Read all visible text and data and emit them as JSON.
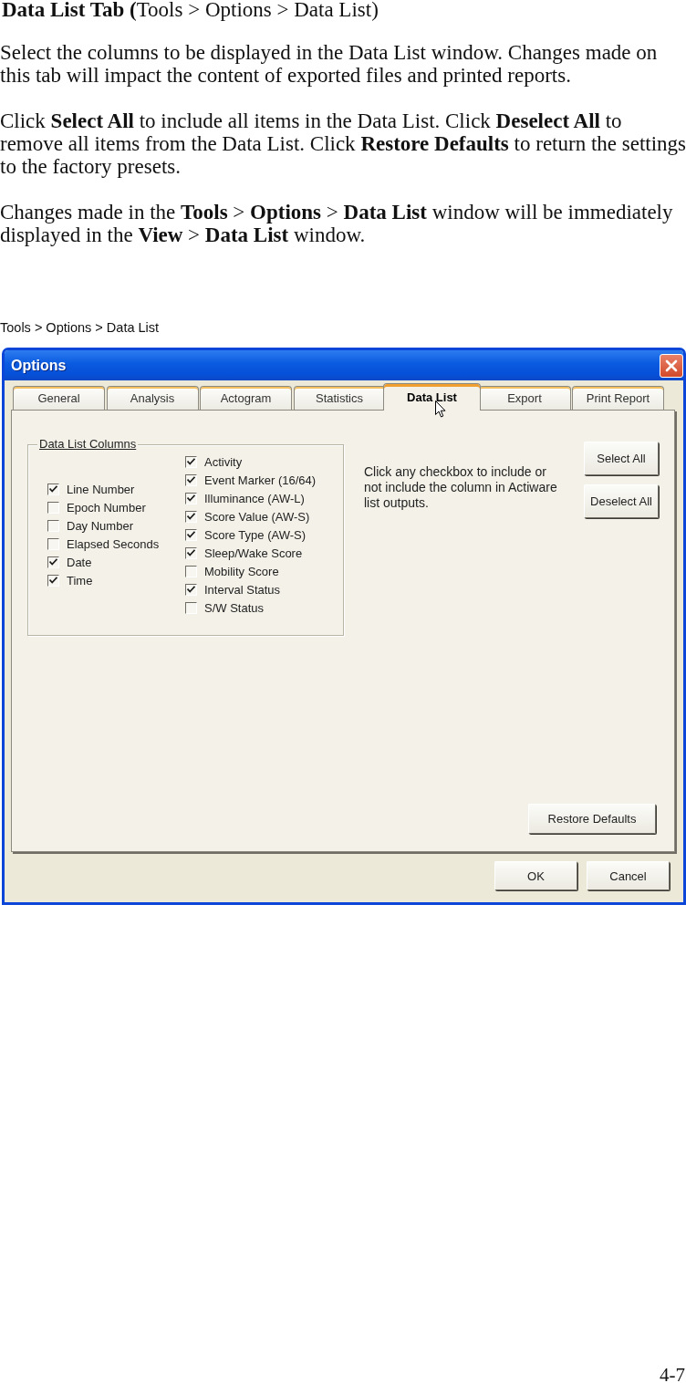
{
  "heading": "**Data List Tab (**Tools > Options > Data List)",
  "paragraphs": [
    "Select the columns to be displayed in the Data List window. Changes made on this tab will impact the content of exported files and printed reports.",
    "Click **Select All** to include all items in the Data List. Click **Deselect All** to remove all items from the Data List. Click **Restore Defaults** to return the settings to the factory presets.",
    "Changes made in the **Tools** > **Options** > **Data List** window will be immediately displayed in the **View** > **Data List** window."
  ],
  "caption": "Tools > Options > Data List",
  "dialog": {
    "title": "Options",
    "tabs": [
      {
        "label": "General",
        "selected": false
      },
      {
        "label": "Analysis",
        "selected": false
      },
      {
        "label": "Actogram",
        "selected": false
      },
      {
        "label": "Statistics",
        "selected": false
      },
      {
        "label": "Data List",
        "selected": true
      },
      {
        "label": "Export",
        "selected": false
      },
      {
        "label": "Print Report",
        "selected": false
      }
    ],
    "group_title": "Data List Columns",
    "checkbox_columns": [
      {
        "items": [
          {
            "label": "Line Number",
            "checked": true
          },
          {
            "label": "Epoch Number",
            "checked": false
          },
          {
            "label": "Day Number",
            "checked": false
          },
          {
            "label": "Elapsed Seconds",
            "checked": false
          },
          {
            "label": "Date",
            "checked": true
          },
          {
            "label": "Time",
            "checked": true
          }
        ]
      },
      {
        "items": [
          {
            "label": "Activity",
            "checked": true
          },
          {
            "label": "Event Marker (16/64)",
            "checked": true
          },
          {
            "label": "Illuminance (AW-L)",
            "checked": true
          },
          {
            "label": "Score Value (AW-S)",
            "checked": true
          },
          {
            "label": "Score Type (AW-S)",
            "checked": true
          },
          {
            "label": "Sleep/Wake Score",
            "checked": true
          },
          {
            "label": "Mobility Score",
            "checked": false
          },
          {
            "label": "Interval Status",
            "checked": true
          },
          {
            "label": "S/W Status",
            "checked": false
          }
        ]
      }
    ],
    "help_text": "Click any checkbox to include or not include the column in Actiware list outputs.",
    "side_buttons": [
      "Select All",
      "Deselect All"
    ],
    "restore_button": "Restore Defaults",
    "footer_buttons": [
      "OK",
      "Cancel"
    ]
  },
  "page_number": "4-7"
}
